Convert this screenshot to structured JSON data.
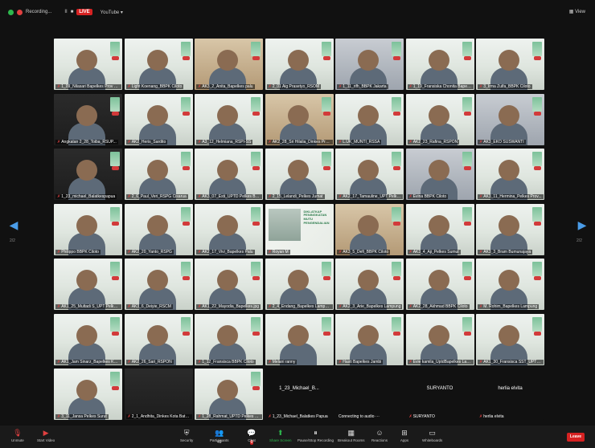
{
  "topbar": {
    "recording_label": "Recording...",
    "pause_label": "II",
    "stop_label": "■",
    "live_label": "LIVE",
    "youtube_label": "YouTube ▾",
    "view_label": "View"
  },
  "pager": {
    "left": "2/2",
    "right": "2/2"
  },
  "participants": [
    "1_09_Nilasari Bapelkes Prov Sulawesi",
    "Light Koenang_BBPK Ciloto",
    "AK3_2_Anita_Bapelkes palu",
    "2_01 Aig Prasetyo_RSOM",
    "1_11_rifh_BBPK Jakarta",
    "1_19_Fransiska Chonita Bapelkes ...",
    "3_Irma Zulfa_BBPK Ciloto",
    "Angkatan 2_28_Toiba_RSUP...",
    "AK2_Heris_Sardito",
    "A3_12_Helmiana_RSPI-SS",
    "AK2_28_Sri Hilalia_Dinkes Prov K...",
    "L.UK_MUNTI_RSSA",
    "AK2_23_Rafina_RSPON",
    "AK3_EKO SUSWANTI",
    "1_23_michael_Balatkespapua",
    "2_6_Paul_Veri_RSPG Cisarua",
    "AK3_07_Esti_UPTD Pelkes Bengku...",
    "2_15_Lelandi_Pelkes Jumat",
    "AK2_17_Tamauline_UPT Pelkes Sul...",
    "Evina BBPK Ciloto",
    "AK3_11_Hermina_Pelkes Prov...",
    "Philippo BBPK Ciloto",
    "AK2_20_Yanto_RSPG",
    "AK2_17_Vivi_Bapelkes Palu",
    "Royan M",
    "AK3_5_Defi_BBPK Ciloto",
    "AK3_4_Aji_Pelkes Sumut",
    "AK3_3_Bram Bumunajaya",
    "AK1_25_Multadi S_UPT Pelkes Pr...",
    "AK3_6_Deiyie_RSCM",
    "AK1_22_Mayodia_Bapelkes.jpg",
    "2_4_Endang_Bapelkes Lampung",
    "AK2_3_Arie_Bapelkes Lampung",
    "AK2_28_Akhmad BBPK Ciloto",
    "M. Rohim_Bapelkes Lampung",
    "AK1_Jam Sinarz_Bapelkes Kalti...",
    "AK2_26_Sari_RSPON",
    "1_12_Fransisca BBPK Ciloto",
    "Melani ranny",
    "Hasti Bapelkes Jambi",
    "Evie kamila_UptdBapelkes Lam...",
    "AK1_30_Fransisca SST_UPTD Bapel...",
    "3_11_Jansa Pelkes Surut",
    "2_1_Andhita_Dinkes Kota Batam",
    "1_28_Rahmat_UPTD Pelkes Bengk...",
    "1_23_Michael_Balatkes Papua",
    "Connecting to audio ···",
    "SURYANTO",
    "herlia elvita"
  ],
  "text_tiles": {
    "michael_big": "1_23_Michael_B...",
    "suryanto_big": "SURYANTO",
    "herlia_big": "herlia elvita"
  },
  "slide_tile": {
    "title": "DIKLATKAP PENINGKATAN MUTU PENGENDALIAN"
  },
  "toolbar": {
    "unmute": "Unmute",
    "start_video": "Start Video",
    "security": "Security",
    "participants": "Participants",
    "participants_count": "49",
    "chat": "Chat",
    "chat_badge": "6",
    "share_screen": "Share Screen",
    "pause_recording": "Pause/Stop Recording",
    "breakout_rooms": "Breakout Rooms",
    "reactions": "Reactions",
    "apps": "Apps",
    "whiteboards": "Whiteboards",
    "leave": "Leave"
  }
}
